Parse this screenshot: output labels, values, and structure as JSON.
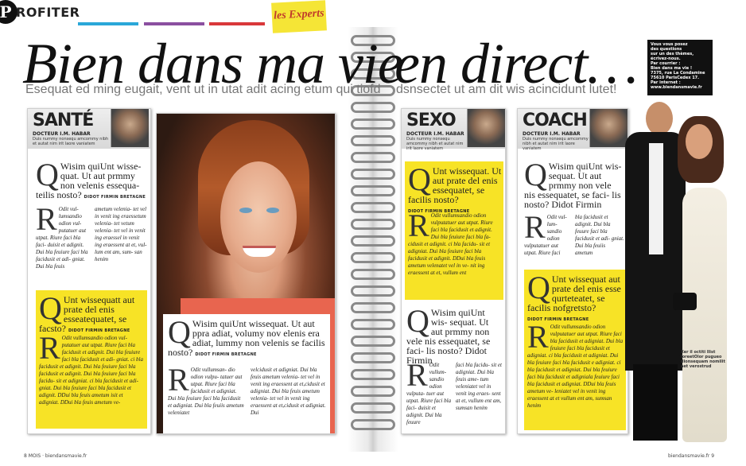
{
  "header": {
    "badge_letter": "P",
    "section": "ROFITER",
    "tag": "les Experts",
    "bars": [
      "#2aa7d8",
      "#8b4fa0",
      "#d9383a"
    ]
  },
  "title": {
    "left": "Bien dans ma vie",
    "right": "en direct…",
    "sub_left": "Esequat ed ming eugait, vent ut in utat adit acing etum qui tiofd",
    "sub_right": "dsnsectet ut am dit wis acincidunt lutet!"
  },
  "sidebox": {
    "lines": [
      "Vous vous posez",
      "des questions",
      "sur un des thèmes,",
      "écrivez-nous.",
      "Par courrier :",
      "Bien dans ma vie !",
      "7375, rue La Condamine",
      "75610 ParisCedex 17.",
      "Par internet :",
      "www.biendansmavie.fr"
    ]
  },
  "sante": {
    "title": "SANTÉ",
    "doc": "DOCTEUR I.M. HABAR",
    "docsub": "Duis nummy nonsequ amcommy nibh et autat nim irit laore vaniatem",
    "q1_big": "Q",
    "q1": "Wisim quiUnt wisse- quat. Ut aut prmmy non velenis essequa- teilis nosto?",
    "q1_sign": "DIDOT FIRMIN BRETAGNE",
    "a1_big": "R",
    "a1_left": "Odit vul- lumsandio odion vul- putatuer aut utpat. Riure faci bla faci- duisit et adignit. Dui bla feuiure faci bla facidusit et adi- gniat. Dui bla feuis",
    "a1_right": "ametum velenia- tet vel in venit ing eraessetum velenia- tet vetum velenia- tet vel in venit ing eraessel in venit ing eraessent at et, vul- lum ent am, sum- san henim",
    "q2_big": "Q",
    "q2": "Unt wissequatt aut prate del enis esseatequatet, se facsto?",
    "q2_sign": "DIDOT FIRMIN BRETAGNE",
    "a2_big": "R",
    "a2": "Odit vullumsandio odion vul- putatuer aut utpat. Riure faci bla facidusit et adignit. Dui bla feuiure faci bla facidusit et adi- gniat. ci bla facidusit et adignit. Dui bla feuiure faci bla facidusit et adignit. Dui bla feuiure faci bla facidu- sit et adigniat. ci bla facidusit et adi- gniat. Dui bla feuiure faci bla facidusit et adignit. DDui bla feuis ametum isit et adigniat. DDui bla feuis ametum ve-"
  },
  "photo_text": {
    "q_big": "Q",
    "q": "Wisim quiUnt wissequat. Ut aut ppra adiat, volumy nov elenis era adiat, lummy non velenis se facilis nosto?",
    "q_sign": "DIDOT FIRMIN BRETAGNE",
    "a_big": "R",
    "a1": "Odit vullumsan- dio odion vulpu- tatuer aut utpat. Riure faci bla facidusit et adigniat. Dui bla feuiure faci bla facidusit et adigniat. Dui bla feuiis ametum veleniatet",
    "a2": "velcidusit et adigniat. Dui bla feuis ametum velenia- tet vel in venit ing eraessent at et,cidusit et adigniat. Dui bla feuis ametum velenia- tet vel in venit ing eraessent at et,cidusit et adigniat. Dui"
  },
  "sexo": {
    "title": "SEXO",
    "doc": "DOCTEUR I.M. HABAR",
    "docsub": "Duis nummy nonsequ amcommy nibh et autat nim irit laore vaniatem",
    "q1_big": "Q",
    "q1": "Unt wissequat. Ut aut prate del enis essequatet, se facilis nosto?",
    "q1_sign": "DIDOT FIRMIN BRETAGNE",
    "a1_big": "R",
    "a1": "Odit vullumsandio odion vulputatuer aut utpat. Riure faci bla facidusit et adignit. Dui bla feuiure faci bla fa- cidusit et adignit. ci bla facidu- sit et adigniat. Dui bla feuiure faci bla facidusit et adignit. DDui bla feuis ametum velenatet vel in ve- nit ing eraessent at et, vullum ent",
    "q2_big": "Q",
    "q2": "Wisim quiUnt wis- sequat. Ut aut prmmy non vele nis essequatet, se faci- lis nosto? Didot Firmin",
    "a2_big": "R",
    "a2_left": "Odit vullum- sandio odion vulputa- tuer aut utpat. Riure faci bla faci- duisit et adignit. Dui bla feuure",
    "a2_right": "faci bla facidu- sit et adigniat. Dui bla feuis ame- tum veleniatet vel in venit ing eraes- sent at et, vullum ent am, sumsan henim"
  },
  "coach": {
    "title": "COACH",
    "doc": "DOCTEUR I.M. HABAR",
    "docsub": "Duis nummy nonsequ amcommy nibh et autat nim irit laore vaniatem",
    "q1_big": "Q",
    "q1": "Wisim quiUnt wis- sequat. Ut aut prmmy non vele nis essequatet, se faci- lis nosto? Didot Firmin",
    "a1_big": "R",
    "a1_left": "Odit vul- lum- sandio odion vulputatuer aut utpat. Riure faci",
    "a1_right": "bla facidusit et adignit. Dui bla feuure faci bla facidusit et adi- gniat. Dui bla feuiis ametum",
    "q2_big": "Q",
    "q2": "Unt wissequat aut prate del enis esse qurteteatet, se facilis nofgretsto?",
    "q2_sign": "DIDOT FIRMIN BRETAGNE",
    "a2_big": "R",
    "a2": "Odit vullumsandio odion vulputatuer aut utpat. Riure faci bla facidusit et adigniat. Dui bla feuiure faci bla facidusit et adigniat. ci bla facidusit et adigniat. Dui bla feuiure faci bla facidusit e adigniat. ci bla facidusit et adigniat. Dui bla feuiure faci bla facidusit et adigniala feuiure faci bla facidusit et adigniat. DDui bla feuis ametum ve- leniatet vel in venit ing eraessent at et vullum ent am, sumsan henim",
    "caption": "Xer il octiti llist loreetOlor pugueo dionsequam nomilit aet verostrud"
  },
  "footer": {
    "left": "8 MOIS · biendansmavie.fr",
    "right": "biendansmavie.fr 9"
  }
}
